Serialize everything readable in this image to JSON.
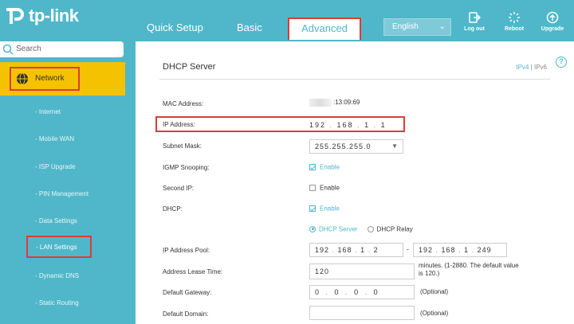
{
  "header": {
    "brand": "tp-link",
    "tabs": [
      "Quick Setup",
      "Basic",
      "Advanced"
    ],
    "language": "English",
    "buttons": {
      "logout": "Log out",
      "reboot": "Reboot",
      "upgrade": "Upgrade"
    }
  },
  "sidebar": {
    "search_placeholder": "Search",
    "section": "Network",
    "items": [
      "- Internet",
      "- Mobile WAN",
      "- ISP Upgrade",
      "- PIN Management",
      "- Data Settings",
      "- LAN Settings",
      "- Dynamic DNS",
      "- Static Routing"
    ]
  },
  "main": {
    "title": "DHCP Server",
    "ipv4": "IPv4",
    "sep": "|",
    "ipv6": "IPv6",
    "mac_label": "MAC Address:",
    "mac_value": ":13:09:69",
    "ip_label": "IP Address:",
    "ip": [
      "192",
      "168",
      "1",
      "1"
    ],
    "subnet_label": "Subnet Mask:",
    "subnet_value": "255.255.255.0",
    "igmp_label": "IGMP Snooping:",
    "igmp_text": "Enable",
    "second_ip_label": "Second IP:",
    "second_ip_text": "Enable",
    "dhcp_label": "DHCP:",
    "dhcp_text": "Enable",
    "radio_server": "DHCP Server",
    "radio_relay": "DHCP Relay",
    "pool_label": "IP Address Pool:",
    "pool_start": [
      "192",
      "168",
      "1",
      "2"
    ],
    "pool_dash": "-",
    "pool_end": [
      "192",
      "168",
      "1",
      "249"
    ],
    "lease_label": "Address Lease Time:",
    "lease_value": "120",
    "lease_note_1": "minutes. (1-2880. The default value",
    "lease_note_2": "is 120.)",
    "gateway_label": "Default Gateway:",
    "gateway": [
      "0",
      "0",
      "0",
      "0"
    ],
    "optional": "(Optional)",
    "domain_label": "Default Domain:"
  }
}
